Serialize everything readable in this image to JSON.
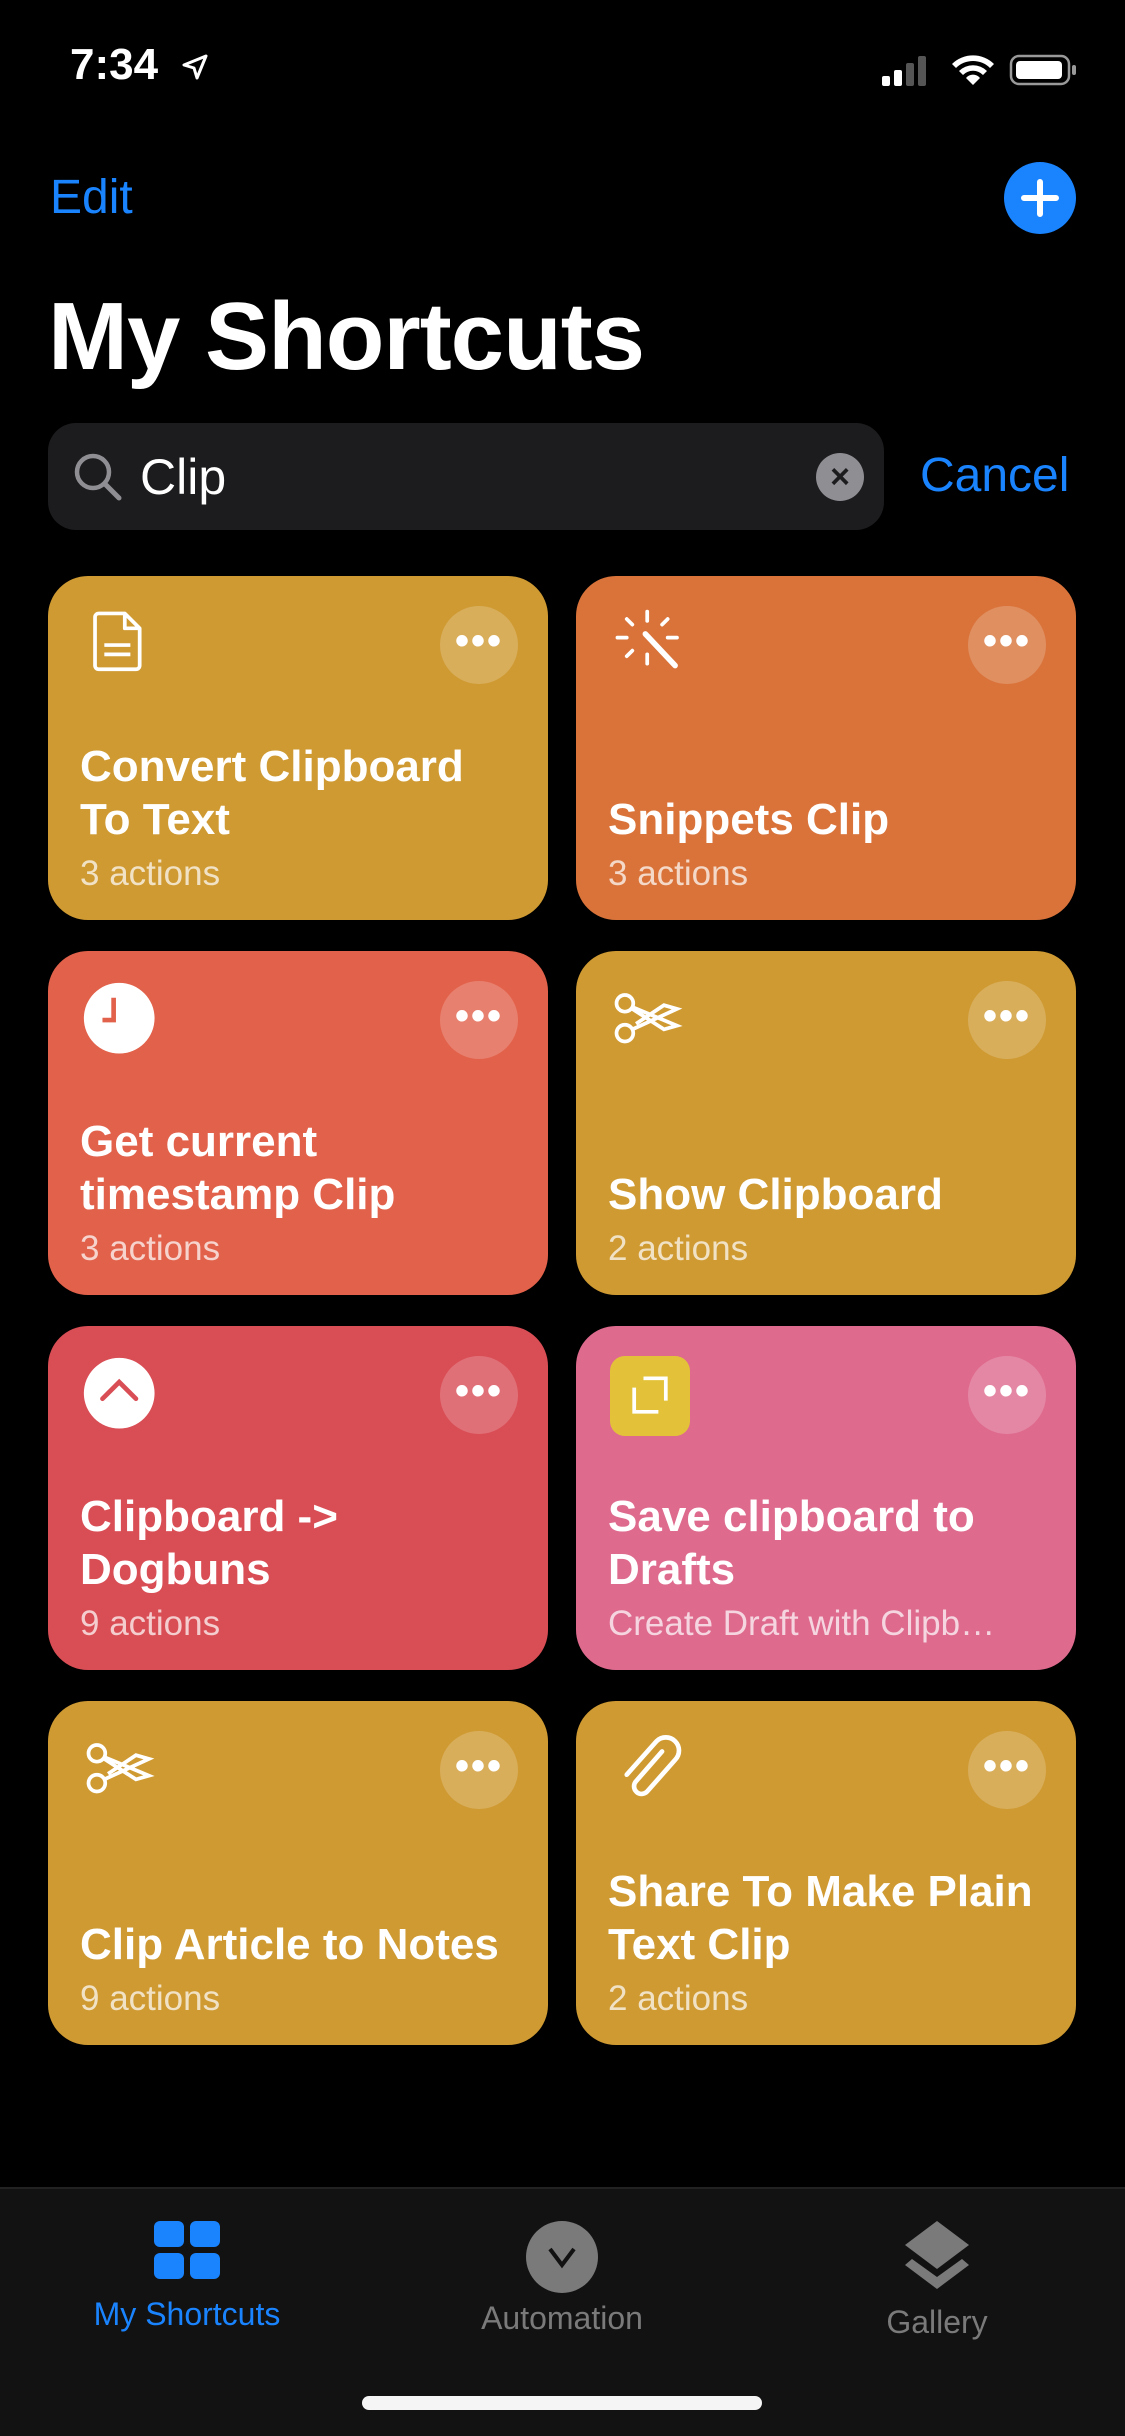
{
  "status": {
    "time": "7:34"
  },
  "header": {
    "edit_label": "Edit",
    "title": "My Shortcuts"
  },
  "search": {
    "value": "Clip",
    "cancel_label": "Cancel"
  },
  "shortcuts": [
    {
      "name": "Convert Clipboard To Text",
      "subtitle": "3 actions",
      "icon": "document-icon",
      "color": "#cf9a32"
    },
    {
      "name": "Snippets Clip",
      "subtitle": "3 actions",
      "icon": "magic-wand-icon",
      "color": "#d9733a"
    },
    {
      "name": "Get current timestamp Clip",
      "subtitle": "3 actions",
      "icon": "clock-icon",
      "color": "#e2614a"
    },
    {
      "name": "Show Clipboard",
      "subtitle": "2 actions",
      "icon": "scissors-icon",
      "color": "#cf9a32"
    },
    {
      "name": "Clipboard -> Dogbuns",
      "subtitle": "9 actions",
      "icon": "chevron-up-icon",
      "color": "#d94d55"
    },
    {
      "name": "Save clipboard to Drafts",
      "subtitle": "Create Draft with Clipb…",
      "icon": "drafts-app-icon",
      "color": "#de6a8e"
    },
    {
      "name": "Clip Article to Notes",
      "subtitle": "9 actions",
      "icon": "scissors-icon",
      "color": "#cf9a32"
    },
    {
      "name": "Share To Make Plain Text Clip",
      "subtitle": "2 actions",
      "icon": "paperclip-icon",
      "color": "#cf9a32"
    }
  ],
  "tabs": [
    {
      "label": "My Shortcuts",
      "active": true
    },
    {
      "label": "Automation"
    },
    {
      "label": "Gallery"
    }
  ],
  "colors": {
    "accent": "#1a84ff",
    "inactive": "#7a7a7a"
  }
}
